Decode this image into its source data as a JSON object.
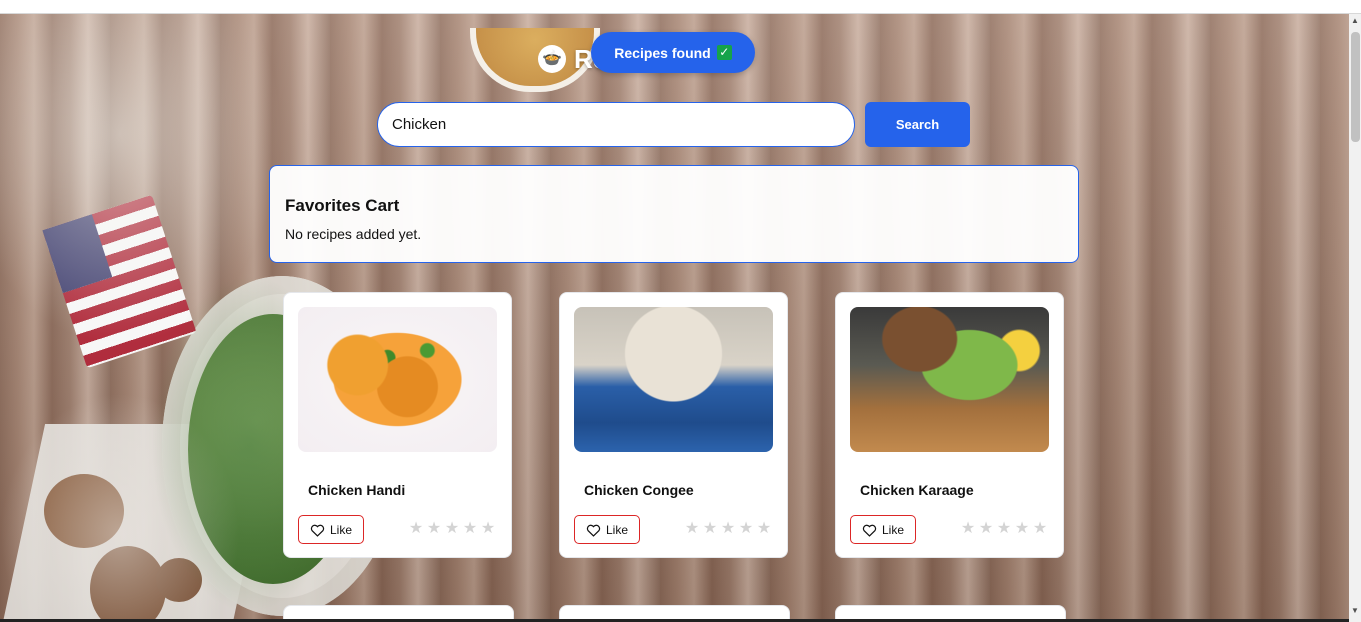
{
  "header": {
    "title": "Re",
    "logo_icon": "🍲"
  },
  "toast": {
    "text": "Recipes found",
    "icon": "✅"
  },
  "search": {
    "value": "Chicken",
    "placeholder": "",
    "button_label": "Search"
  },
  "favorites": {
    "title": "Favorites Cart",
    "empty_text": "No recipes added yet."
  },
  "recipes": [
    {
      "name": "Chicken Handi",
      "like_label": "Like",
      "rating": 0
    },
    {
      "name": "Chicken Congee",
      "like_label": "Like",
      "rating": 0
    },
    {
      "name": "Chicken Karaage",
      "like_label": "Like",
      "rating": 0
    }
  ],
  "colors": {
    "accent": "#2563eb",
    "like_border": "#dc2626",
    "star_empty": "#d4d4d4"
  },
  "stars": "★"
}
